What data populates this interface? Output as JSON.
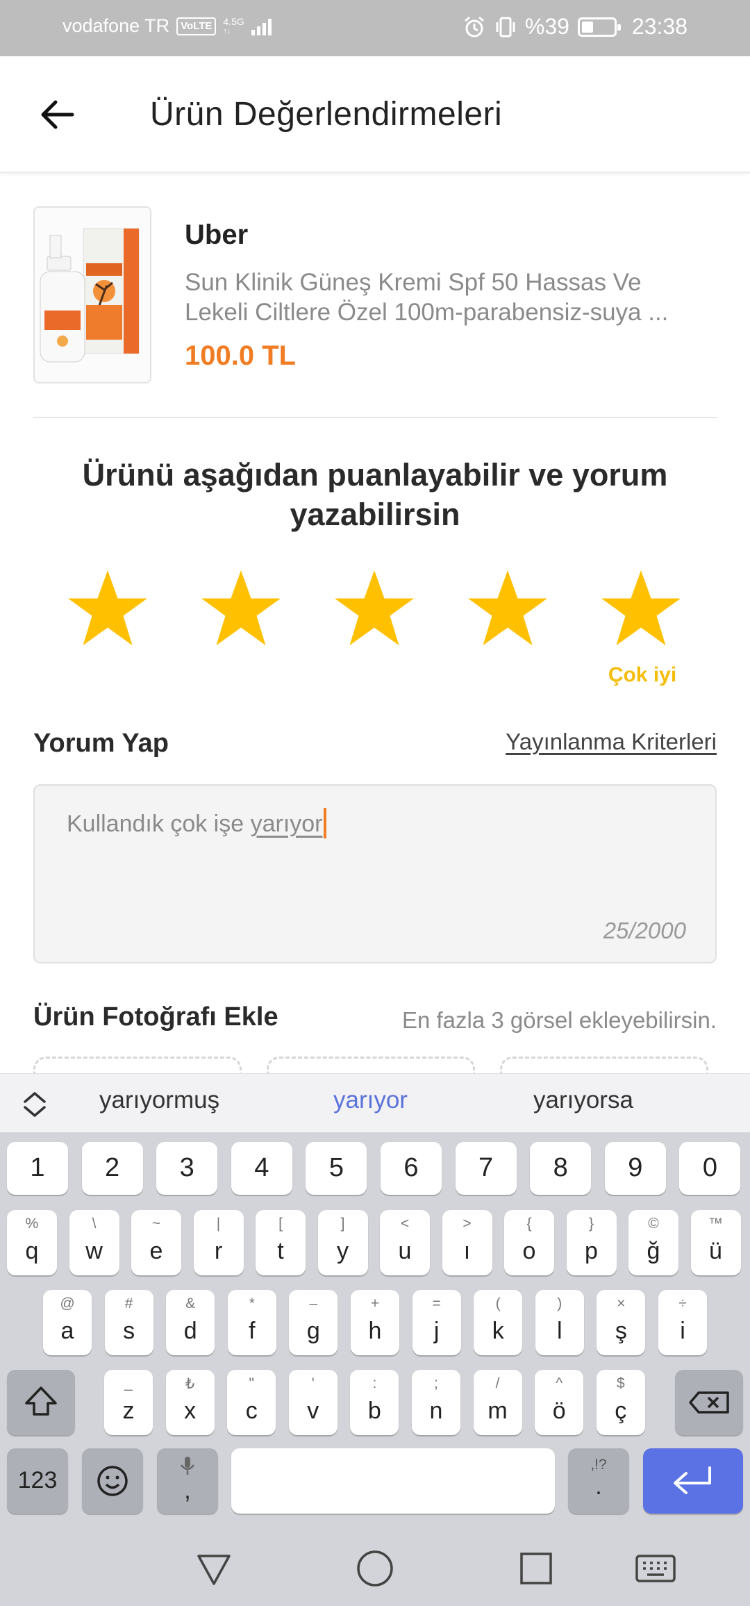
{
  "status_bar": {
    "carrier": "vodafone TR",
    "volte": "VoLTE",
    "network": "4.5G",
    "battery_text": "%39",
    "time": "23:38"
  },
  "header": {
    "title": "Ürün Değerlendirmeleri"
  },
  "product": {
    "brand": "Uber",
    "description": "Sun Klinik Güneş Kremi Spf 50 Hassas Ve Lekeli Ciltlere Özel 100m-parabensiz-suya ...",
    "price": "100.0 TL"
  },
  "rating": {
    "prompt": "Ürünü aşağıdan puanlayabilir ve yorum yazabilirsin",
    "stars_filled": 5,
    "stars_total": 5,
    "label": "Çok iyi",
    "star_color": "#FFC000"
  },
  "comment": {
    "title": "Yorum Yap",
    "criteria_link": "Yayınlanma Kriterleri",
    "text_prefix": "Kullandık çok işe ",
    "text_underlined": "yarıyor",
    "counter": "25/2000"
  },
  "photos": {
    "title": "Ürün Fotoğrafı Ekle",
    "hint": "En fazla 3 görsel ekleyebilirsin."
  },
  "keyboard": {
    "suggestions": [
      "yarıyormuş",
      "yarıyor",
      "yarıyorsa"
    ],
    "number_row": [
      "1",
      "2",
      "3",
      "4",
      "5",
      "6",
      "7",
      "8",
      "9",
      "0"
    ],
    "row1": [
      {
        "k": "q",
        "a": "%"
      },
      {
        "k": "w",
        "a": "\\"
      },
      {
        "k": "e",
        "a": "~"
      },
      {
        "k": "r",
        "a": "|"
      },
      {
        "k": "t",
        "a": "["
      },
      {
        "k": "y",
        "a": "]"
      },
      {
        "k": "u",
        "a": "<"
      },
      {
        "k": "ı",
        "a": ">"
      },
      {
        "k": "o",
        "a": "{"
      },
      {
        "k": "p",
        "a": "}"
      },
      {
        "k": "ğ",
        "a": "©"
      },
      {
        "k": "ü",
        "a": "™"
      }
    ],
    "row2": [
      {
        "k": "a",
        "a": "@"
      },
      {
        "k": "s",
        "a": "#"
      },
      {
        "k": "d",
        "a": "&"
      },
      {
        "k": "f",
        "a": "*"
      },
      {
        "k": "g",
        "a": "–"
      },
      {
        "k": "h",
        "a": "+"
      },
      {
        "k": "j",
        "a": "="
      },
      {
        "k": "k",
        "a": "("
      },
      {
        "k": "l",
        "a": ")"
      },
      {
        "k": "ş",
        "a": "×"
      },
      {
        "k": "i",
        "a": "÷"
      }
    ],
    "row3": [
      {
        "k": "z",
        "a": "_"
      },
      {
        "k": "x",
        "a": "₺"
      },
      {
        "k": "c",
        "a": "\""
      },
      {
        "k": "v",
        "a": "'"
      },
      {
        "k": "b",
        "a": ":"
      },
      {
        "k": "n",
        "a": ";"
      },
      {
        "k": "m",
        "a": "/"
      },
      {
        "k": "ö",
        "a": "^"
      },
      {
        "k": "ç",
        "a": "$"
      }
    ],
    "numbers_key": "123",
    "comma_key": ",",
    "period_key": ".",
    "period_alt": ",!?"
  }
}
